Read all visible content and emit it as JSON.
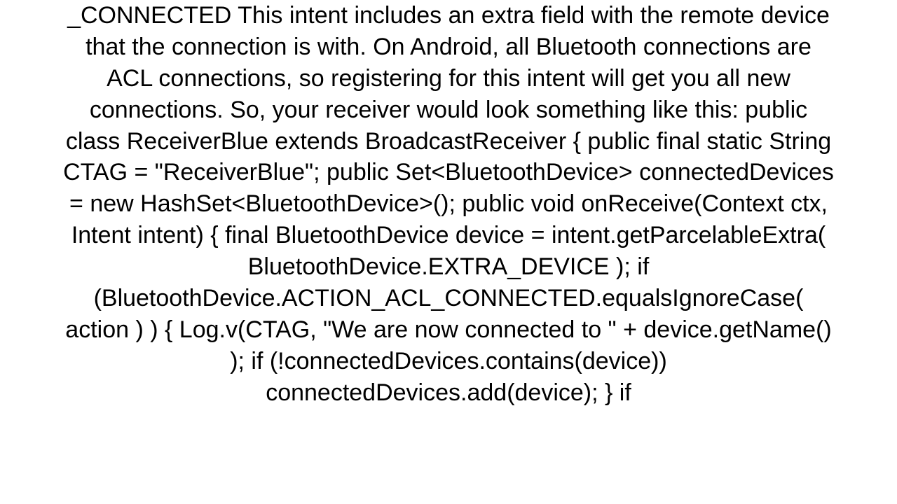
{
  "document": {
    "body_text": "_CONNECTED This intent includes an extra field with the remote device that the connection is with. On Android, all Bluetooth connections are ACL connections, so registering for this intent will get you all new connections. So, your receiver would look something like this: public class ReceiverBlue extends BroadcastReceiver {   public final static String CTAG = \"ReceiverBlue\";   public Set<BluetoothDevice> connectedDevices = new HashSet<BluetoothDevice>();    public void onReceive(Context ctx, Intent intent) {      final BluetoothDevice device = intent.getParcelableExtra( BluetoothDevice.EXTRA_DEVICE );      if (BluetoothDevice.ACTION_ACL_CONNECTED.equalsIgnoreCase( action ) )   {       Log.v(CTAG, \"We are now connected to \" + device.getName() );       if (!connectedDevices.contains(device))         connectedDevices.add(device);     }      if"
  }
}
